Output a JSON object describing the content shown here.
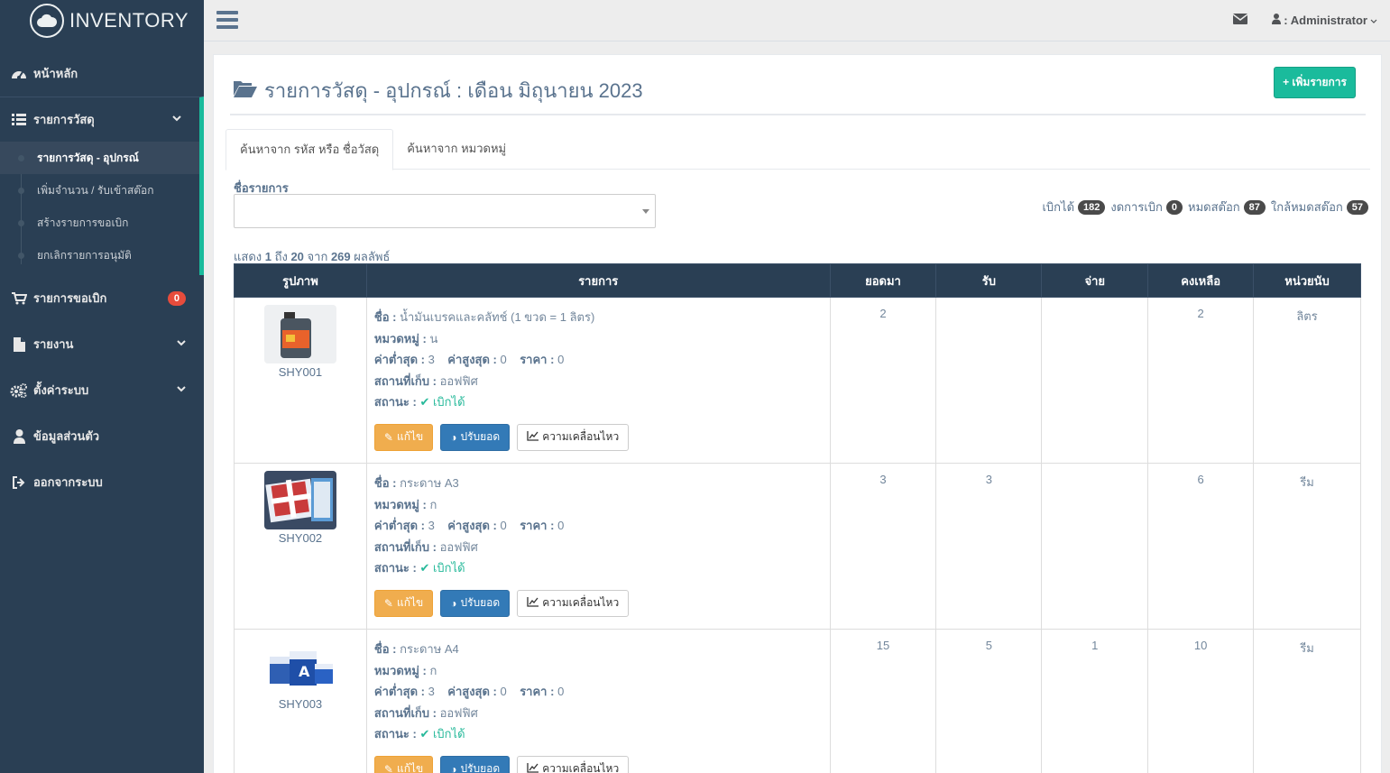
{
  "brand": {
    "title": "INVENTORY",
    "logo_icon": "cloud-icon"
  },
  "sidebar": {
    "items": [
      {
        "label": "หน้าหลัก",
        "icon": "dashboard-icon"
      },
      {
        "label": "รายการวัสดุ",
        "icon": "list-icon"
      },
      {
        "label": "รายการขอเบิก",
        "icon": "cart-icon",
        "badge": "0"
      },
      {
        "label": "รายงาน",
        "icon": "file-icon"
      },
      {
        "label": "ตั้งค่าระบบ",
        "icon": "cogs-icon"
      },
      {
        "label": "ข้อมูลส่วนตัว",
        "icon": "user-icon"
      },
      {
        "label": "ออกจากระบบ",
        "icon": "sign-out-icon"
      }
    ],
    "submenu": [
      "รายการวัสดุ - อุปกรณ์",
      "เพิ่มจำนวน / รับเข้าสต๊อก",
      "สร้างรายการขอเบิก",
      "ยกเลิกรายการอนุมัติ"
    ]
  },
  "topnav": {
    "user": ": Administrator"
  },
  "page": {
    "title": "รายการวัสดุ - อุปกรณ์ : เดือน มิถุนายน 2023",
    "add_button": "เพิ่มรายการ",
    "tabs": [
      "ค้นหาจาก รหัส หรือ ชื่อวัสดุ",
      "ค้นหาจาก หมวดหมู่"
    ],
    "field_label": "ชื่อรายการ",
    "select_value": "",
    "stats": [
      {
        "label": "เบิกได้",
        "value": "182"
      },
      {
        "label": "งดการเบิก",
        "value": "0"
      },
      {
        "label": "หมดสต๊อก",
        "value": "87"
      },
      {
        "label": "ใกล้หมดสต๊อก",
        "value": "57"
      }
    ],
    "showing_prefix": "แสดง",
    "showing_from": "1",
    "showing_mid": "ถึง",
    "showing_to": "20",
    "showing_of": "จาก",
    "showing_total": "269",
    "showing_suffix": "ผลลัพธ์"
  },
  "table": {
    "headers": [
      "รูปภาพ",
      "รายการ",
      "ยอดมา",
      "รับ",
      "จ่าย",
      "คงเหลือ",
      "หน่วยนับ"
    ],
    "labels": {
      "name": "ชื่อ :",
      "category": "หมวดหมู่ :",
      "min": "ค่าต่ำสุด :",
      "max": "ค่าสูงสุด :",
      "price": "ราคา :",
      "location": "สถานที่เก็บ :",
      "status": "สถานะ :",
      "edit": "แก้ไข",
      "adjust": "ปรับยอด",
      "movement": "ความเคลื่อนไหว"
    },
    "rows": [
      {
        "code": "SHY001",
        "name": "น้ำมันเบรคและคลัทช์ (1 ขวด = 1 ลิตร)",
        "category": "น",
        "min": "3",
        "max": "0",
        "price": "0",
        "location": "ออฟฟิศ",
        "status": "เบิกได้",
        "brought": "2",
        "received": "",
        "paid": "",
        "remaining": "2",
        "unit": "ลิตร"
      },
      {
        "code": "SHY002",
        "name": "กระดาษ A3",
        "category": "ก",
        "min": "3",
        "max": "0",
        "price": "0",
        "location": "ออฟฟิศ",
        "status": "เบิกได้",
        "brought": "3",
        "received": "3",
        "paid": "",
        "remaining": "6",
        "unit": "รีม"
      },
      {
        "code": "SHY003",
        "name": "กระดาษ A4",
        "category": "ก",
        "min": "3",
        "max": "0",
        "price": "0",
        "location": "ออฟฟิศ",
        "status": "เบิกได้",
        "brought": "15",
        "received": "5",
        "paid": "1",
        "remaining": "10",
        "unit": "รีม"
      }
    ]
  }
}
